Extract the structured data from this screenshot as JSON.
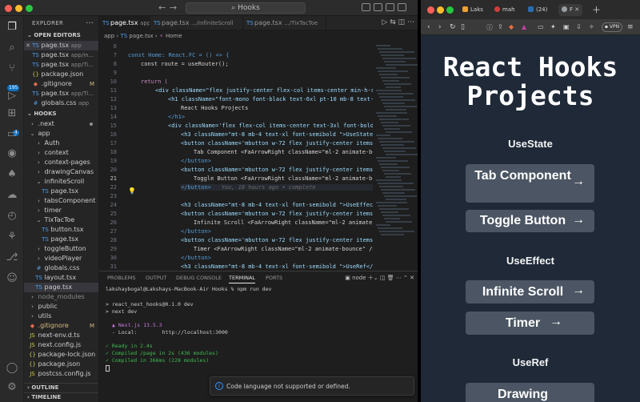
{
  "vscode": {
    "command_center": "Hooks",
    "activity_badges": {
      "source_control": "195",
      "extensions": "4"
    },
    "explorer": {
      "title": "EXPLORER",
      "open_editors_label": "OPEN EDITORS",
      "open_editors": [
        {
          "name": "page.tsx",
          "desc": "app"
        },
        {
          "name": "page.tsx",
          "desc": "app/in..."
        },
        {
          "name": "page.tsx",
          "desc": "app/Ti..."
        },
        {
          "name": "package.json",
          "desc": ""
        },
        {
          "name": ".gitignore",
          "desc": "",
          "mark": "M"
        },
        {
          "name": "page.tsx",
          "desc": "app/Ti..."
        },
        {
          "name": "globals.css",
          "desc": "app"
        }
      ],
      "project_label": "HOOKS",
      "tree": [
        ".next",
        "app",
        "Auth",
        "context",
        "context-pages",
        "drawingCanvas",
        "infiniteScroll",
        "page.tsx",
        "tabsComponent",
        "timer",
        "TixTacToe",
        "button.tsx",
        "page.tsx",
        "toggleButton",
        "videoPlayer",
        "globals.css",
        "layout.tsx",
        "page.tsx",
        "node_modules",
        "public",
        "utils",
        ".gitignore",
        "next-env.d.ts",
        "next.config.js",
        "package-lock.json",
        "package.json",
        "postcss.config.js"
      ],
      "gitignore_mark": "M",
      "outline_label": "OUTLINE",
      "timeline_label": "TIMELINE"
    },
    "tabs": [
      {
        "name": "page.tsx",
        "desc": "app"
      },
      {
        "name": "page.tsx",
        "desc": ".../infiniteScroll"
      },
      {
        "name": "page.tsx",
        "desc": ".../TixTacToe"
      }
    ],
    "breadcrumb": [
      "app",
      "page.tsx",
      "Home"
    ],
    "line_numbers": [
      "5",
      "6",
      "7",
      "8",
      "9",
      "10",
      "11",
      "12",
      "13",
      "14",
      "15",
      "16",
      "17",
      "18",
      "19",
      "20",
      "21",
      "22",
      "23",
      "24",
      "25",
      "26",
      "27",
      "28",
      "29",
      "30",
      "31"
    ],
    "code": {
      "l6": "const Home: React.FC = () => {",
      "l7": "const route = useRouter();",
      "l9": "return (",
      "l10": "<div className=\"flex justify-center flex-col items-center min-h-sc",
      "l11": "<h1 className=\"font-mono font-black text-6xl pt-10 mb-8 text-c",
      "l12": "React Hooks Projects",
      "l13": "</h1>",
      "l14": "<div className='flex flex-col items-center text-3xl font-bold",
      "l15": "<h3 className=\"mt-8 mb-4 text-xl font-semibold \">UseState</",
      "l16": "<button className='mbutton w-72 flex justify-center items-ce",
      "l17": "Tab Component <FaArrowRight className=\"ml-2 animate-bo",
      "l18": "</button>",
      "l19": "<button className='mbutton w-72 flex justify-center items-ce",
      "l20": "Toggle Button <FaArrowRight className=\"ml-2 animate-bo",
      "l21": "</button>",
      "l21_blame": "You, 18 hours ago • complete",
      "l23": "<h3 className=\"mt-8 mb-4 text-xl font-semibold \">UseEffect",
      "l24": "<button className='mbutton w-72 flex justify-center items-ce",
      "l25": "Infinite Scroll <FaArrowRight className=\"ml-2 animate-",
      "l26": "</button>",
      "l27": "<button className='mbutton w-72 flex justify-center items-",
      "l28": "Timer <FaArrowRight className=\"ml-2 animate-bounce\" />",
      "l29": "</button>",
      "l31": "<h3 className=\"mt-8 mb-4 text-xl font-semibold \">UseRef</h",
      "l32": "<button className='mbutton w-72 flex justify-center items-ce"
    },
    "panel": {
      "tabs": [
        "PROBLEMS",
        "OUTPUT",
        "DEBUG CONSOLE",
        "TERMINAL",
        "PORTS"
      ],
      "terminal_name": "node",
      "prompt": "lakshaybogal@Lakshays-MacBook-Air Hooks % npm run dev",
      "lines": [
        "> react_next_hooks@0.1.0 dev",
        "> next dev",
        "▲ Next.js 13.5.3",
        "- Local:        http://localhost:3000",
        "✓ Ready in 2.4s",
        "✓ Compiled /page in 2s (436 modules)",
        "✓ Compiled in 366ms (228 modules)"
      ]
    },
    "toast": "Code language not supported or defined."
  },
  "browser": {
    "tabs": [
      {
        "label": "Laks",
        "color": "#f0a030"
      },
      {
        "label": "mah",
        "color": "#d33c3c"
      },
      {
        "label": "(24)",
        "color": "#2b6cb0"
      },
      {
        "label": "F",
        "color": "#9aa0a6"
      }
    ],
    "vpn_label": "VPN",
    "page": {
      "title_line1": "React Hooks",
      "title_line2": "Projects",
      "sections": [
        {
          "heading": "UseState",
          "buttons": [
            "Tab Component",
            "Toggle Button"
          ]
        },
        {
          "heading": "UseEffect",
          "buttons": [
            "Infinite Scroll",
            "Timer"
          ]
        },
        {
          "heading": "UseRef",
          "buttons": [
            "Drawing"
          ]
        }
      ],
      "arrow": "→"
    }
  }
}
